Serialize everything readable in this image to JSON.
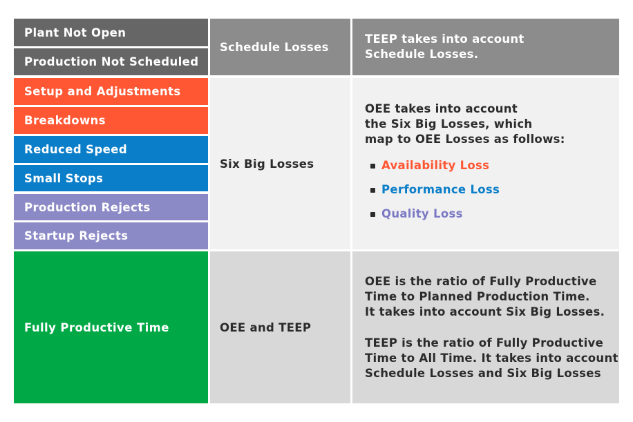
{
  "colors": {
    "schedule_gray": "#666666",
    "header_gray": "#8c8c8c",
    "availability": "#ff5733",
    "performance": "#0a7ec8",
    "quality": "#8c8ac6",
    "productive": "#00a846"
  },
  "left_items": [
    {
      "label": "Plant Not Open",
      "category": "schedule"
    },
    {
      "label": "Production Not Scheduled",
      "category": "schedule"
    },
    {
      "label": "Setup and Adjustments",
      "category": "availability"
    },
    {
      "label": "Breakdowns",
      "category": "availability"
    },
    {
      "label": "Reduced Speed",
      "category": "performance"
    },
    {
      "label": "Small Stops",
      "category": "performance"
    },
    {
      "label": "Production Rejects",
      "category": "quality"
    },
    {
      "label": "Startup Rejects",
      "category": "quality"
    },
    {
      "label": "Fully Productive Time",
      "category": "productive"
    }
  ],
  "middle": {
    "schedule": "Schedule Losses",
    "six_big": "Six Big Losses",
    "oee_teep": "OEE and TEEP"
  },
  "right": {
    "schedule": "TEEP takes into account\nSchedule Losses.",
    "six_big_intro": "OEE takes into account\nthe Six Big Losses, which\nmap to OEE Losses as follows:",
    "losses": [
      {
        "label": "Availability Loss",
        "color": "#ff5733"
      },
      {
        "label": "Performance Loss",
        "color": "#0a7ec8"
      },
      {
        "label": "Quality Loss",
        "color": "#7b79c4"
      }
    ],
    "oee_para": "OEE is the ratio of Fully Productive\nTime to Planned Production Time.\nIt takes into account Six Big Losses.",
    "teep_para": "TEEP is the ratio of Fully Productive\nTime to All Time. It takes into account\nSchedule Losses and Six Big Losses"
  }
}
